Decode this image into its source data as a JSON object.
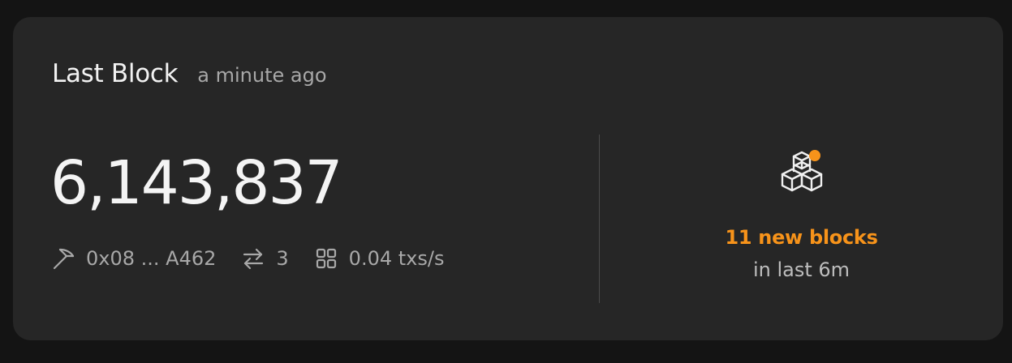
{
  "card": {
    "title": "Last Block",
    "time_ago": "a minute ago",
    "block_number": "6,143,837",
    "miner": "0x08 ... A462",
    "tx_count": "3",
    "tx_rate": "0.04 txs/s",
    "new_blocks": "11 new blocks",
    "period": "in last 6m"
  },
  "icons": {
    "miner": "pickaxe-icon",
    "transactions": "swap-arrows-icon",
    "rate": "grid-icon",
    "blocks": "cubes-icon"
  },
  "colors": {
    "accent": "#f7931a",
    "card_bg": "#262626",
    "page_bg": "#141414"
  }
}
